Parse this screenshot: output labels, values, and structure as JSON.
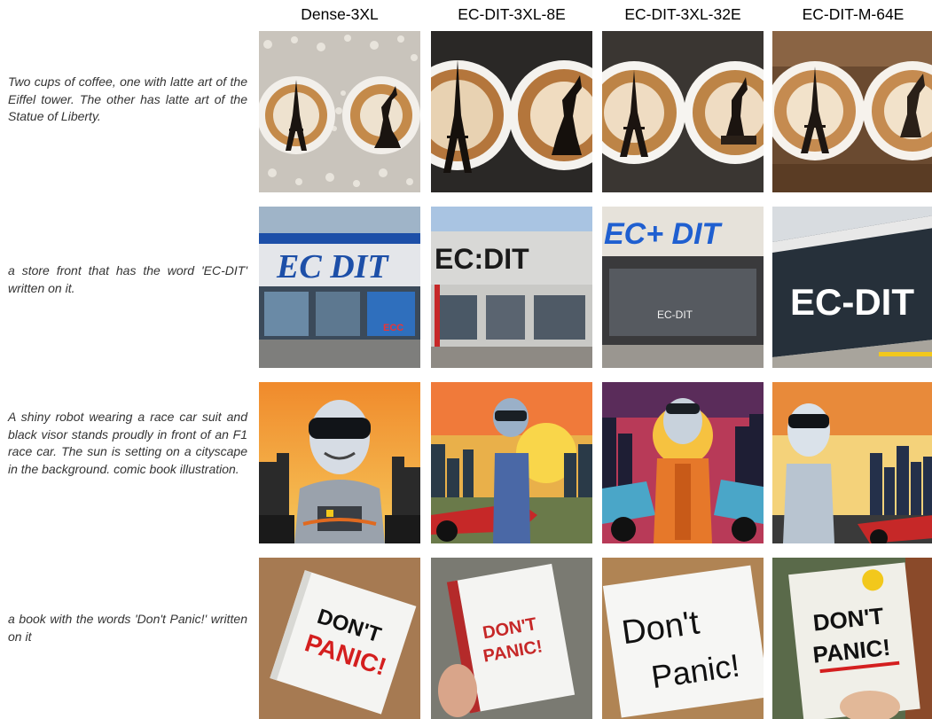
{
  "columns": [
    "Dense-3XL",
    "EC-DIT-3XL-8E",
    "EC-DIT-3XL-32E",
    "EC-DIT-M-64E"
  ],
  "prompts": [
    "Two cups of coffee, one with latte art of the Eiffel tower. The other has latte art of the Statue of Liberty.",
    "a store front that has the word 'EC-DIT' written on it.",
    "A shiny robot wearing a race car suit and black visor stands proudly in front of an F1 race car. The sun is setting on a cityscape in the background. comic book illustration.",
    "a book with the words 'Don't Panic!' written on it"
  ],
  "images": {
    "store": [
      "EC DIT",
      "EC:DIT",
      "EC+ DIT",
      "EC-DIT"
    ],
    "store_window": [
      "ECC",
      "",
      "EC-DIT",
      ""
    ],
    "book_line1": [
      "DON'T",
      "DON'T",
      "Don't",
      "DON'T"
    ],
    "book_line2": [
      "PANIC!",
      "PANIC!",
      "Panic!",
      "PANIC!"
    ]
  }
}
